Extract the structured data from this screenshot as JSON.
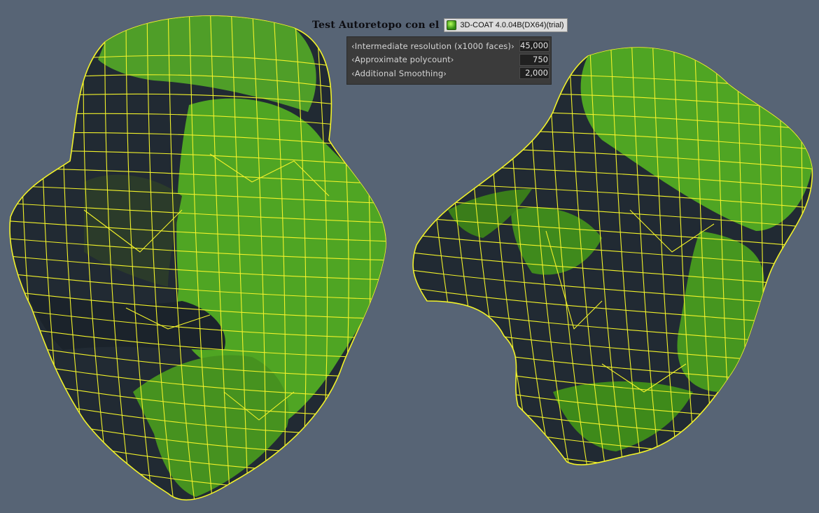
{
  "title": "Test Autoretopo con el",
  "app_badge": {
    "label": "3D-COAT 4.0.04B(DX64)(trial)",
    "icon": "3dcoat-logo-icon"
  },
  "autoretopo_params": [
    {
      "label": "‹Intermediate resolution (x1000 faces)›",
      "value": "45,000"
    },
    {
      "label": "‹Approximate polycount›",
      "value": "750"
    },
    {
      "label": "‹Additional Smoothing›",
      "value": "2,000"
    }
  ],
  "colors": {
    "background": "#576475",
    "mesh_dark": "#212a33",
    "mesh_green": "#4fa523",
    "wireframe": "#f2f22a"
  }
}
